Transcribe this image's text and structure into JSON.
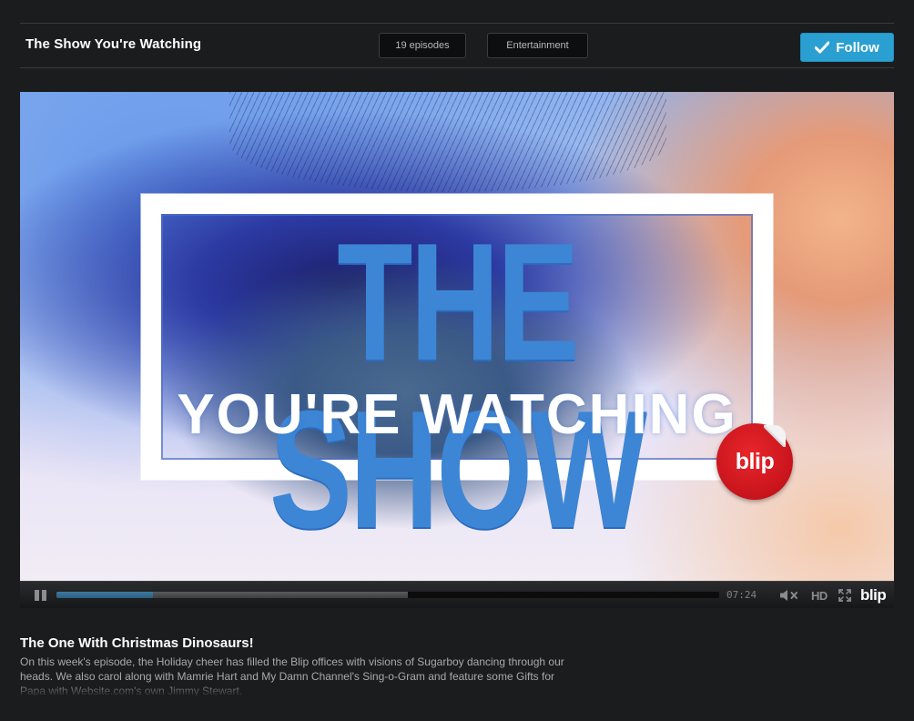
{
  "header": {
    "show_title": "The Show You're Watching",
    "episodes_label": "19 episodes",
    "genre_label": "Entertainment",
    "follow_label": "Follow"
  },
  "video": {
    "title_line1": "THE SHOW",
    "title_line2": "YOU'RE WATCHING",
    "badge_text": "blip"
  },
  "player": {
    "time": "07:24",
    "played_fraction": 0.145,
    "buffered_fraction": 0.53,
    "hd_label": "HD",
    "brand": "blip"
  },
  "episode": {
    "title": "The One With Christmas Dinosaurs!",
    "description": "On this week's episode, the Holiday cheer has filled the Blip offices with visions of Sugarboy dancing through our heads. We also carol along with Mamrie Hart and My Damn Channel's Sing-o-Gram and feature some Gifts for Papa with Website.com's own Jimmy Stewart."
  },
  "colors": {
    "background": "#1b1c1e",
    "follow_button": "#2a9fd2",
    "logo_blue": "#3d86d6",
    "blip_red": "#d41b22"
  }
}
